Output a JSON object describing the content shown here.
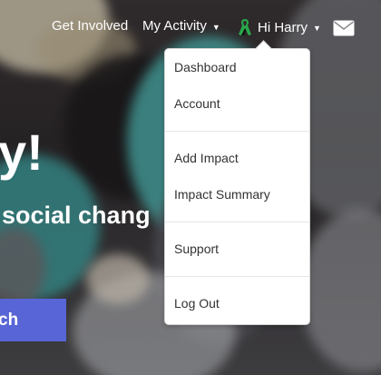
{
  "nav": {
    "get_involved": "Get Involved",
    "my_activity": "My Activity",
    "greeting": "Hi Harry",
    "caret_icon": "chevron-down-icon",
    "profile_icon": "awareness-ribbon-icon",
    "mail_icon": "envelope-icon"
  },
  "hero": {
    "title": "y!",
    "subtitle": "social chang",
    "cta_label": "ch"
  },
  "dropdown": {
    "items": [
      {
        "label": "Dashboard"
      },
      {
        "label": "Account"
      },
      {
        "label": "Add Impact"
      },
      {
        "label": "Impact Summary"
      },
      {
        "label": "Support"
      },
      {
        "label": "Log Out"
      }
    ]
  },
  "colors": {
    "cta": "#5865d6",
    "ribbon_green": "#2aa84a",
    "ribbon_black": "#111111"
  }
}
